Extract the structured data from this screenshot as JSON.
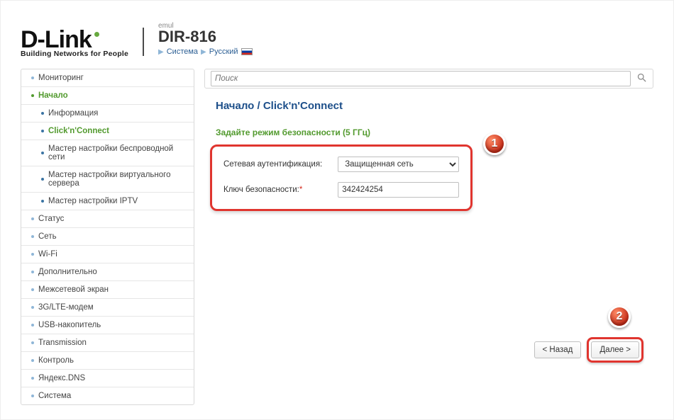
{
  "header": {
    "brand": "D-Link",
    "tagline": "Building Networks for People",
    "emul_label": "emul",
    "model": "DIR-816",
    "bc_system": "Система",
    "bc_lang": "Русский"
  },
  "search": {
    "placeholder": "Поиск"
  },
  "sidebar": {
    "items": [
      {
        "label": "Мониторинг",
        "type": "top"
      },
      {
        "label": "Начало",
        "type": "top",
        "active": true
      },
      {
        "label": "Информация",
        "type": "sub"
      },
      {
        "label": "Click'n'Connect",
        "type": "sub",
        "active": true
      },
      {
        "label": "Мастер настройки беспроводной сети",
        "type": "sub"
      },
      {
        "label": "Мастер настройки виртуального сервера",
        "type": "sub"
      },
      {
        "label": "Мастер настройки IPTV",
        "type": "sub"
      },
      {
        "label": "Статус",
        "type": "top"
      },
      {
        "label": "Сеть",
        "type": "top"
      },
      {
        "label": "Wi-Fi",
        "type": "top"
      },
      {
        "label": "Дополнительно",
        "type": "top"
      },
      {
        "label": "Межсетевой экран",
        "type": "top"
      },
      {
        "label": "3G/LTE-модем",
        "type": "top"
      },
      {
        "label": "USB-накопитель",
        "type": "top"
      },
      {
        "label": "Transmission",
        "type": "top"
      },
      {
        "label": "Контроль",
        "type": "top"
      },
      {
        "label": "Яндекс.DNS",
        "type": "top"
      },
      {
        "label": "Система",
        "type": "top"
      }
    ]
  },
  "main": {
    "breadcrumb": "Начало /  Click'n'Connect",
    "section_title": "Задайте режим безопасности (5 ГГц)",
    "auth_label": "Сетевая аутентификация:",
    "auth_value": "Защищенная сеть",
    "key_label": "Ключ безопасности:",
    "key_value": "342424254"
  },
  "buttons": {
    "back": "< Назад",
    "next": "Далее >"
  },
  "annotations": {
    "a1": "1",
    "a2": "2"
  }
}
